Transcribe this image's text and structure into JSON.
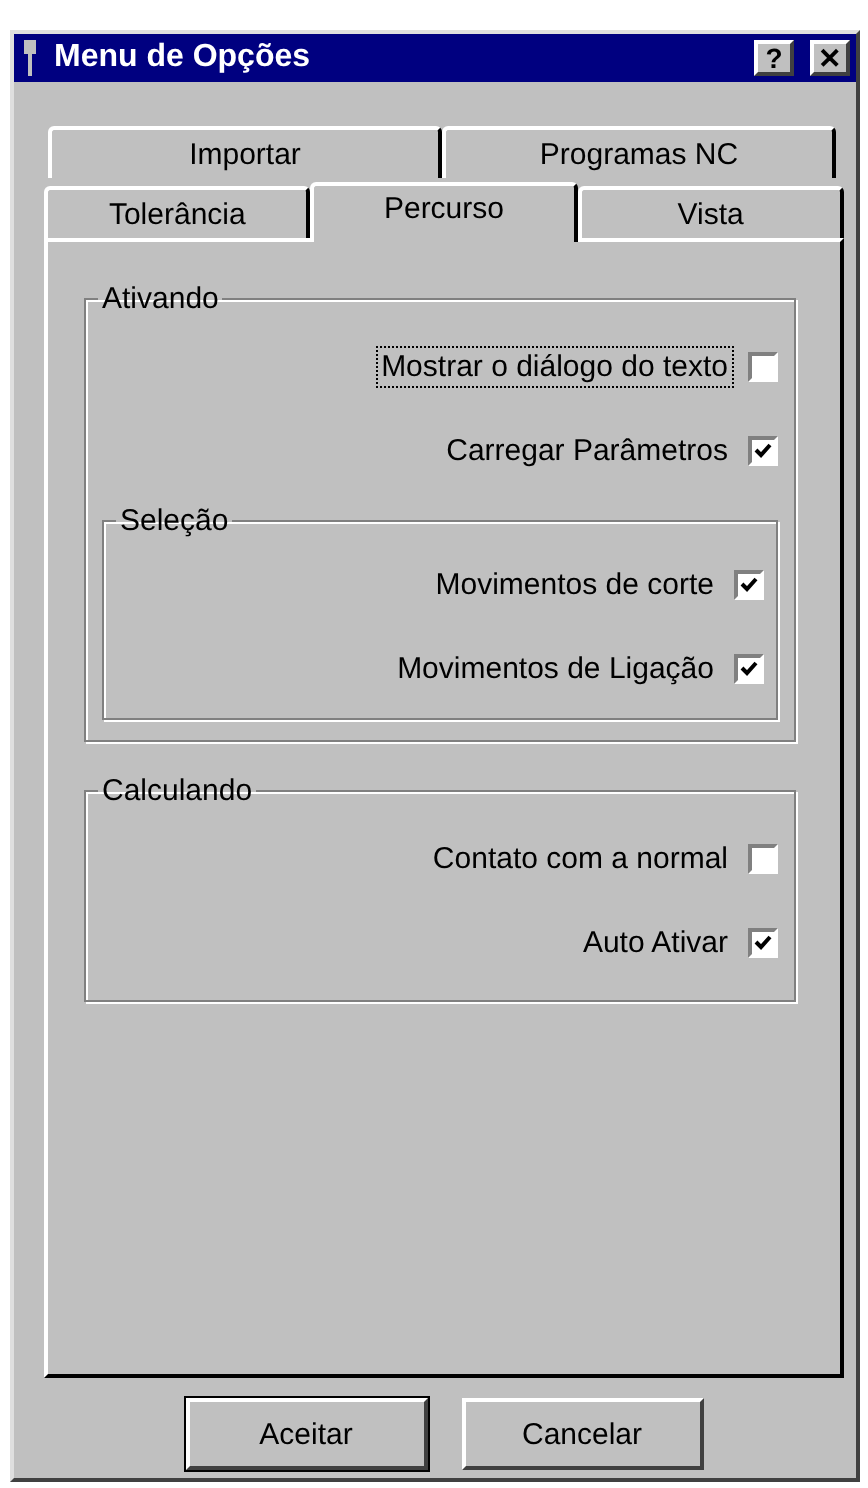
{
  "window": {
    "title": "Menu de Opções",
    "help_button": "?",
    "close_button": "✕"
  },
  "tab_rows": [
    [
      {
        "label": "Importar",
        "selected": false
      },
      {
        "label": "Programas NC",
        "selected": false
      }
    ],
    [
      {
        "label": "Tolerância",
        "selected": false
      },
      {
        "label": "Percurso",
        "selected": true
      },
      {
        "label": "Vista",
        "selected": false
      }
    ]
  ],
  "groups": [
    {
      "title": "Ativando",
      "items": [
        {
          "label": "Mostrar o diálogo do texto",
          "checked": false,
          "focused": true
        },
        {
          "label": "Carregar Parâmetros",
          "checked": true,
          "focused": false
        }
      ],
      "groups": [
        {
          "title": "Seleção",
          "items": [
            {
              "label": "Movimentos de corte",
              "checked": true,
              "focused": false
            },
            {
              "label": "Movimentos de Ligação",
              "checked": true,
              "focused": false
            }
          ]
        }
      ]
    },
    {
      "title": "Calculando",
      "items": [
        {
          "label": "Contato com a normal",
          "checked": false,
          "focused": false
        },
        {
          "label": "Auto Ativar",
          "checked": true,
          "focused": false
        }
      ]
    }
  ],
  "buttons": [
    {
      "label": "Aceitar",
      "default": true
    },
    {
      "label": "Cancelar",
      "default": false
    }
  ]
}
